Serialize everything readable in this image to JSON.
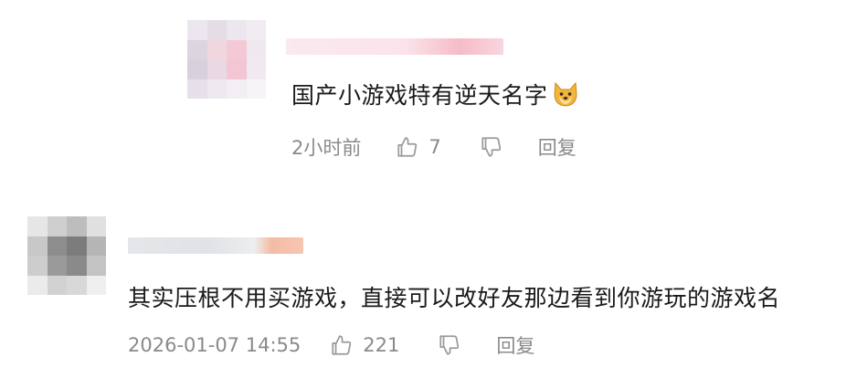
{
  "comments": [
    {
      "text": "国产小游戏特有逆天名字",
      "emoji": "dog-face-emoji",
      "time": "2小时前",
      "likes": "7",
      "reply_label": "回复"
    },
    {
      "text": "其实压根不用买游戏，直接可以改好友那边看到你游玩的游戏名",
      "time": "2026-01-07 14:55",
      "likes": "221",
      "reply_label": "回复"
    }
  ],
  "colors": {
    "text": "#1a1a1a",
    "meta": "#8a8a8a",
    "icon_stroke": "#9a9a9a"
  },
  "icons": {
    "like": "thumbs-up-icon",
    "dislike": "thumbs-down-icon"
  }
}
